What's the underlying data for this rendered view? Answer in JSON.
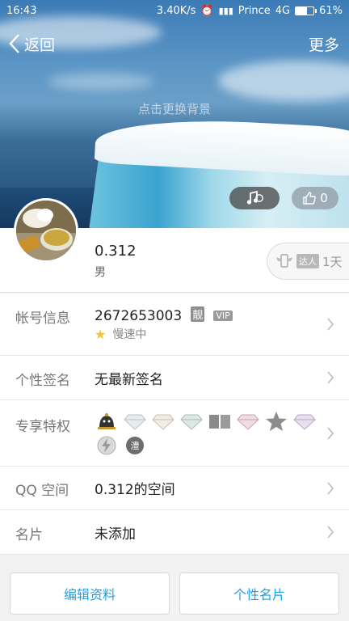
{
  "status_bar": {
    "time": "16:43",
    "speed": "3.40K/s",
    "carrier": "Prince",
    "network": "4G",
    "battery": "61%",
    "battery_level": 0.61
  },
  "nav": {
    "back_label": "返回",
    "more_label": "更多"
  },
  "banner": {
    "change_bg_label": "点击更换背景",
    "like_count": "0"
  },
  "profile": {
    "nickname": "0.312",
    "gender": "男",
    "daren_badge": "达人",
    "daren_days": "1天"
  },
  "rows": {
    "account": {
      "label": "帐号信息",
      "qq_number": "2672653003",
      "liang_tag": "靓",
      "vip_tag": "VIP",
      "speed_status": "慢速中"
    },
    "signature": {
      "label": "个性签名",
      "value": "无最新签名"
    },
    "privileges": {
      "label": "专享特权",
      "icons": [
        "penguin-bell-icon",
        "diamond-icon",
        "diamond-icon",
        "diamond-icon",
        "book-icon",
        "diamond-pink-icon",
        "star-icon",
        "diamond-purple-icon",
        "lightning-icon",
        "skin-icon"
      ]
    },
    "qzone": {
      "label": "QQ 空间",
      "value": "0.312的空间"
    },
    "card": {
      "label": "名片",
      "value": "未添加"
    }
  },
  "buttons": {
    "edit_profile": "编辑资料",
    "personal_card": "个性名片"
  },
  "colors": {
    "accent": "#1e9fe8",
    "label_gray": "#777777"
  }
}
